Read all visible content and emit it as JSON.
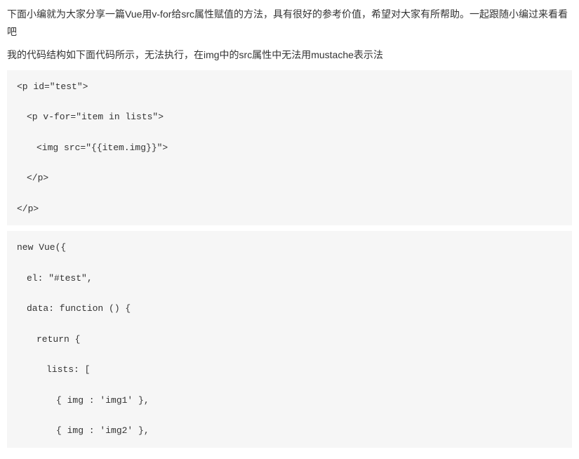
{
  "intro_paragraph": "下面小编就为大家分享一篇Vue用v-for给src属性赋值的方法，具有很好的参考价值，希望对大家有所帮助。一起跟随小编过来看看吧",
  "desc_paragraph": "我的代码结构如下面代码所示，无法执行，在img中的src属性中无法用mustache表示法",
  "code_block_1": {
    "line1": "<p id=\"test\">",
    "line2": "<p v-for=\"item in lists\">",
    "line3": "<img src=\"{{item.img}}\">",
    "line4": "</p>",
    "line5": "</p>"
  },
  "code_block_2": {
    "line1": "new Vue({",
    "line2": "el: \"#test\",",
    "line3": "data: function () {",
    "line4": "return {",
    "line5": "lists: [",
    "line6": "{ img : 'img1' },",
    "line7": "{ img : 'img2' },"
  }
}
